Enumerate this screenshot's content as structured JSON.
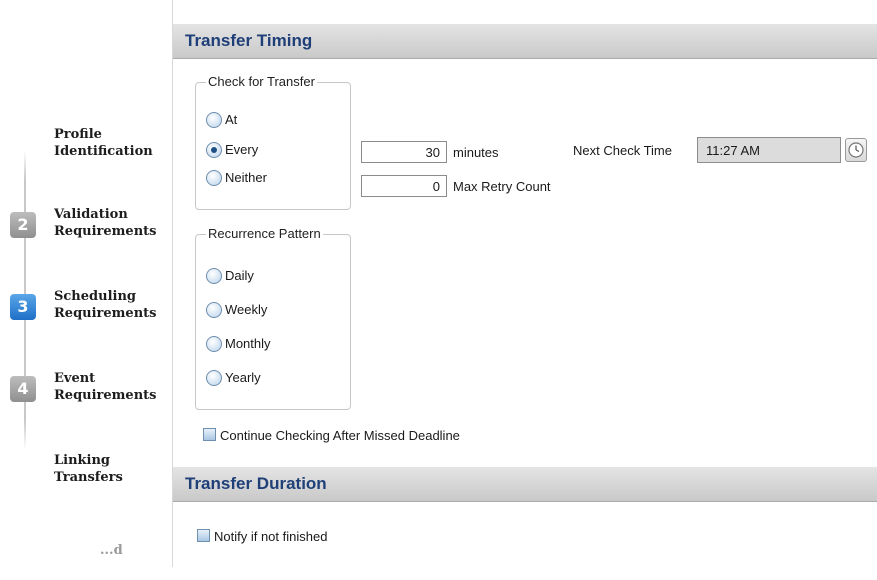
{
  "wizard": {
    "steps": [
      {
        "number": "",
        "label": "Profile\nIdentification"
      },
      {
        "number": "2",
        "label": "Validation\nRequirements"
      },
      {
        "number": "3",
        "label": "Scheduling\nRequirements"
      },
      {
        "number": "4",
        "label": "Event\nRequirements"
      },
      {
        "number": "",
        "label": "Linking\nTransfers"
      },
      {
        "number": "",
        "label": "...d"
      }
    ]
  },
  "transfer_timing": {
    "title": "Transfer Timing",
    "check_for_transfer": {
      "legend": "Check for Transfer",
      "options": [
        {
          "label": "At",
          "selected": false
        },
        {
          "label": "Every",
          "selected": true
        },
        {
          "label": "Neither",
          "selected": false
        }
      ]
    },
    "interval": {
      "value": "30",
      "unit_label": "minutes"
    },
    "retry": {
      "value": "0",
      "label": "Max Retry Count"
    },
    "next_check": {
      "label": "Next Check Time",
      "value": "11:27 AM",
      "icon": "clock-icon"
    },
    "recurrence_pattern": {
      "legend": "Recurrence Pattern",
      "options": [
        {
          "label": "Daily",
          "selected": false
        },
        {
          "label": "Weekly",
          "selected": false
        },
        {
          "label": "Monthly",
          "selected": false
        },
        {
          "label": "Yearly",
          "selected": false
        }
      ]
    },
    "continue_checking": {
      "label": "Continue Checking After Missed Deadline",
      "checked": false
    }
  },
  "transfer_duration": {
    "title": "Transfer Duration",
    "notify": {
      "label": "Notify if not finished",
      "checked": false
    }
  },
  "colors": {
    "header_text": "#1f3f78",
    "active_step": "#1e6fc8",
    "inactive_step": "#9e9e9e"
  }
}
